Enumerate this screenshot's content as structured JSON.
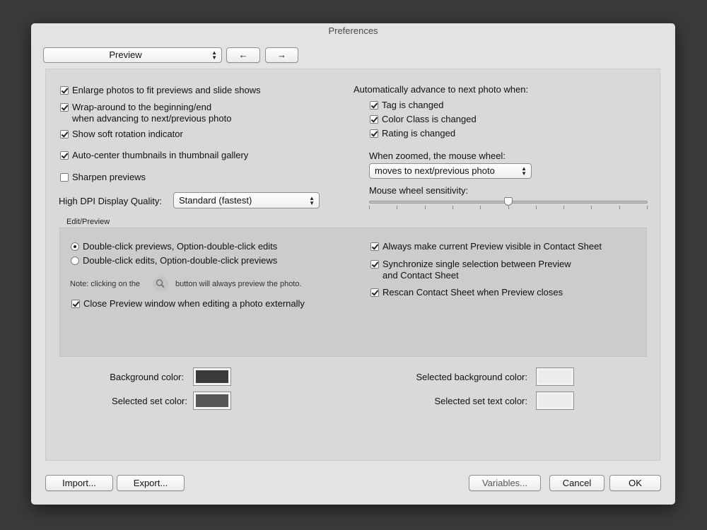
{
  "window": {
    "title": "Preferences"
  },
  "toolbar": {
    "category": "Preview",
    "back_glyph": "←",
    "forward_glyph": "→"
  },
  "left_options": [
    {
      "label": "Enlarge photos to fit previews and slide shows",
      "checked": true
    },
    {
      "label": "Wrap-around to the beginning/end",
      "label2": "when advancing to next/previous photo",
      "checked": true
    },
    {
      "label": "Show soft rotation indicator",
      "checked": true
    },
    {
      "label": "Auto-center thumbnails in thumbnail gallery",
      "checked": true
    },
    {
      "label": "Sharpen previews",
      "checked": false
    }
  ],
  "dpi": {
    "label": "High DPI Display Quality:",
    "value": "Standard (fastest)"
  },
  "advance": {
    "heading": "Automatically advance to next photo when:",
    "options": [
      {
        "label": "Tag is changed",
        "checked": true
      },
      {
        "label": "Color Class is changed",
        "checked": true
      },
      {
        "label": "Rating is changed",
        "checked": true
      }
    ]
  },
  "zoom": {
    "label": "When zoomed, the mouse wheel:",
    "value": "moves to next/previous photo"
  },
  "sensitivity": {
    "label": "Mouse wheel sensitivity:",
    "value": 0.5,
    "ticks": 11
  },
  "edit_preview": {
    "title": "Edit/Preview",
    "radios": [
      {
        "label": "Double-click previews, Option-double-click edits",
        "selected": true
      },
      {
        "label": "Double-click edits, Option-double-click previews",
        "selected": false
      }
    ],
    "note_before": "Note: clicking on the",
    "note_after": "button will always preview the photo.",
    "close_option": {
      "label": "Close Preview window when editing a photo externally",
      "checked": true
    },
    "right_options": [
      {
        "label": "Always make current Preview visible in Contact Sheet",
        "checked": true
      },
      {
        "label": "Synchronize single selection between Preview",
        "label2": "and Contact Sheet",
        "checked": true
      },
      {
        "label": "Rescan Contact Sheet when Preview closes",
        "checked": true
      }
    ]
  },
  "colors": {
    "background": {
      "label": "Background color:",
      "hex": "#3a3a3a"
    },
    "selected_set": {
      "label": "Selected set color:",
      "hex": "#555555"
    },
    "selected_background": {
      "label": "Selected background color:",
      "hex": "#ececec"
    },
    "selected_set_text": {
      "label": "Selected set text color:",
      "hex": "#ececec"
    }
  },
  "footer": {
    "import": "Import...",
    "export": "Export...",
    "variables": "Variables...",
    "cancel": "Cancel",
    "ok": "OK"
  }
}
